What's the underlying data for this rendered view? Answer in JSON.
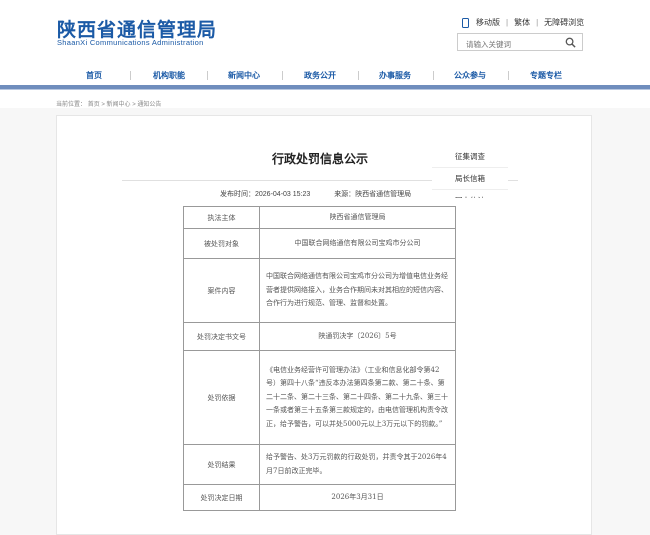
{
  "header": {
    "logo_cn": "陕西省通信管理局",
    "logo_en": "ShaanXi Communications Administration",
    "toplinks": [
      "移动版",
      "繁体",
      "无障碍浏览"
    ],
    "search_placeholder": "请输入关键词"
  },
  "nav": {
    "items": [
      "首页",
      "机构职能",
      "新闻中心",
      "政务公开",
      "办事服务",
      "公众参与",
      "专题专栏"
    ]
  },
  "breadcrumb": {
    "prefix": "当前位置：",
    "items": [
      "首页",
      "新闻中心",
      "通知公告"
    ],
    "sep": " > "
  },
  "article": {
    "title": "行政处罚信息公示",
    "publish_label": "发布时间：",
    "publish_time": "2026-04-03 15:23",
    "source_label": "来源：",
    "source": "陕西省通信管理局"
  },
  "side_menu": [
    "征集调查",
    "局长信箱",
    "网上信访"
  ],
  "table": [
    {
      "k": "执法主体",
      "v": "陕西省通信管理局",
      "center": true
    },
    {
      "k": "被处罚对象",
      "v": "中国联合网络通信有限公司宝鸡市分公司",
      "center": true
    },
    {
      "k": "案件内容",
      "v": "中国联合网络通信有限公司宝鸡市分公司为增值电信业务经营者提供网络接入，业务合作期间未对其相应的短信内容、合作行为进行规范、管理、监督和处置。",
      "center": false
    },
    {
      "k": "处罚决定书文号",
      "v": "陕通罚决字〔2026〕5号",
      "center": true
    },
    {
      "k": "处罚依据",
      "v": "《电信业务经营许可管理办法》（工业和信息化部令第42号）第四十八条“违反本办法第四条第二款、第二十条、第二十二条、第二十三条、第二十四条、第二十九条、第三十一条或者第三十五条第三款规定的，由电信管理机构责令改正，给予警告，可以并处5000元以上3万元以下的罚款。”",
      "center": false
    },
    {
      "k": "处罚结果",
      "v": "给予警告、处3万元罚款的行政处罚，并责令其于2026年4月7日前改正完毕。",
      "center": false
    },
    {
      "k": "处罚决定日期",
      "v": "2026年3月31日",
      "center": true
    }
  ]
}
